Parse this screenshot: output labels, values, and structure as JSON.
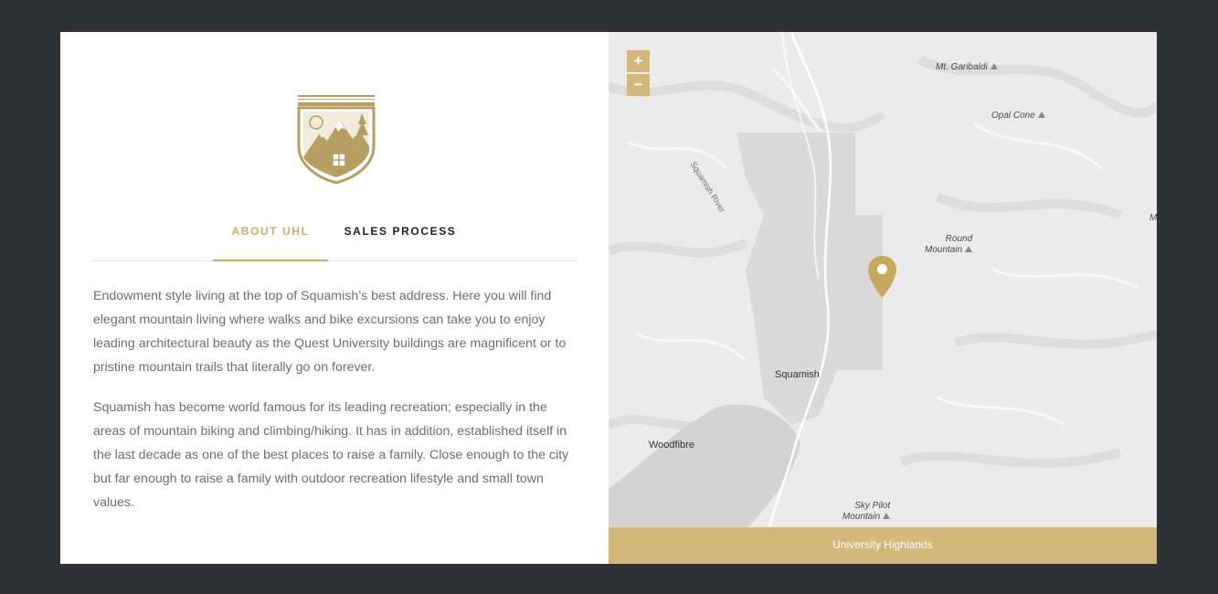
{
  "colors": {
    "background": "#303134",
    "gold": "#c9ad6a",
    "text": "#6e6e6e",
    "map_bar": "#d2b97b"
  },
  "logo": {
    "icon": "mountain-crest-icon"
  },
  "tabs": [
    {
      "label": "ABOUT UHL",
      "active": true
    },
    {
      "label": "SALES PROCESS",
      "active": false
    }
  ],
  "content": {
    "paragraphs": [
      "Endowment style living at the top of Squamish’s best address. Here you will find elegant mountain living where walks and bike excursions can take you to enjoy leading architectural beauty as the Quest University buildings are magnificent or to pristine mountain trails that literally go on forever.",
      "Squamish has become world famous for its leading recreation; especially in the areas of mountain biking and climbing/hiking. It has in addition, established itself in the last decade as one of the best places to raise a family. Close enough to the city but far enough to raise a family with outdoor recreation lifestyle and small town values."
    ]
  },
  "map": {
    "zoom_in": "+",
    "zoom_out": "−",
    "labels": {
      "garibaldi": "Mt. Garibaldi",
      "opal_cone": "Opal Cone",
      "squamish_river": "Squamish River",
      "round_mountain_1": "Round",
      "round_mountain_2": "Mountain",
      "squamish": "Squamish",
      "woodfibre": "Woodfibre",
      "sky_pilot_1": "Sky Pilot",
      "sky_pilot_2": "Mountain",
      "edge_m": "M"
    },
    "marker_icon": "map-pin-icon",
    "footer_label": "University Highlands"
  }
}
